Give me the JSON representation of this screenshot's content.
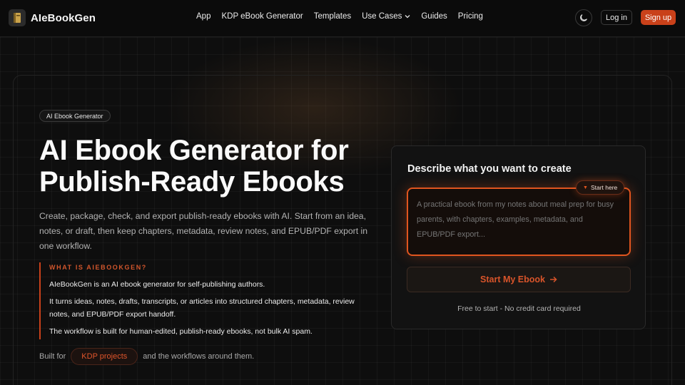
{
  "brand": {
    "name": "AIeBookGen"
  },
  "nav": {
    "links": [
      "App",
      "KDP eBook Generator",
      "Templates",
      "Use Cases",
      "Guides",
      "Pricing"
    ],
    "login": "Log in",
    "signup": "Sign up",
    "accent_color": "#c9411a"
  },
  "hero": {
    "badge": "AI Ebook Generator",
    "title_line1": "AI Ebook Generator for",
    "title_line2": "Publish-Ready Ebooks",
    "description": "Create, package, check, and export publish-ready ebooks with AI. Start from an idea, notes, or draft, then keep chapters, metadata, review notes, and EPUB/PDF export in one workflow."
  },
  "what": {
    "label": "WHAT IS AIEBOOKGEN?",
    "p1": "AIeBookGen is an AI ebook generator for self-publishing authors.",
    "p2": "It turns ideas, notes, drafts, transcripts, or articles into structured chapters, metadata, review notes, and EPUB/PDF export handoff.",
    "p3": "The workflow is built for human-edited, publish-ready ebooks, not bulk AI spam."
  },
  "built": {
    "prefix": "Built for",
    "pill": "KDP projects",
    "suffix": "and the workflows around them."
  },
  "card": {
    "title": "Describe what you want to create",
    "start_here": "Start here",
    "placeholder": "A practical ebook from my notes about meal prep for busy parents, with chapters, examples, metadata, and EPUB/PDF export...",
    "button": "Start My Ebook",
    "note": "Free to start - No credit card required"
  }
}
